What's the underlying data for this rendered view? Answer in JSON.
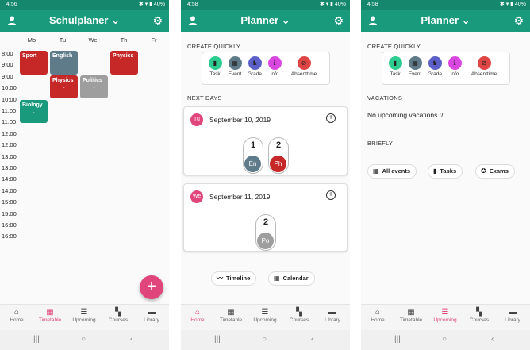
{
  "screens": [
    {
      "status": {
        "time": "4:56",
        "battery": "40%"
      },
      "title": "Schulplaner",
      "days": [
        "Mo",
        "Tu",
        "We",
        "Th",
        "Fr"
      ],
      "hours": [
        "8:00",
        "9:00",
        "9:00",
        "10:00",
        "10:00",
        "11:00",
        "11:00",
        "12:00",
        "12:00",
        "13:00",
        "13:00",
        "14:00",
        "14:00",
        "15:00",
        "15:00",
        "16:00",
        "16:00"
      ],
      "lessons": [
        {
          "name": "Sport",
          "sub": "-",
          "color": "#c62828"
        },
        {
          "name": "English",
          "sub": "-",
          "color": "#5f7b8a"
        },
        {
          "name": "Physics",
          "sub": "-",
          "color": "#c62828"
        },
        {
          "name": "Physics",
          "sub": "-",
          "color": "#c62828"
        },
        {
          "name": "Politics",
          "sub": "-",
          "color": "#9e9e9e"
        },
        {
          "name": "Biology",
          "sub": "-",
          "color": "#1a9a7d"
        }
      ],
      "fab": "+",
      "nav": [
        "Home",
        "Timetable",
        "Upcoming",
        "Courses",
        "Library"
      ],
      "active_nav": "Timetable"
    },
    {
      "status": {
        "time": "4:58",
        "battery": "40%"
      },
      "title": "Planner",
      "create_quickly": "CREATE QUICKLY",
      "quick": [
        "Task",
        "Event",
        "Grade",
        "Info",
        "Absenttime"
      ],
      "next_days": "NEXT DAYS",
      "cards": [
        {
          "day": "Tu",
          "date": "September 10, 2019",
          "entries": [
            {
              "num": "1",
              "abbr": "En",
              "color": "#5f7b8a"
            },
            {
              "num": "2",
              "abbr": "Ph",
              "color": "#c62828"
            }
          ]
        },
        {
          "day": "We",
          "date": "September 11, 2019",
          "entries": [
            {
              "num": "2",
              "abbr": "Po",
              "color": "#9e9e9e"
            }
          ]
        }
      ],
      "buttons": [
        "Timeline",
        "Calendar"
      ],
      "nav": [
        "Home",
        "Timetable",
        "Upcoming",
        "Courses",
        "Library"
      ],
      "active_nav": "Home"
    },
    {
      "status": {
        "time": "4:58",
        "battery": "40%"
      },
      "title": "Planner",
      "create_quickly": "CREATE QUICKLY",
      "quick": [
        "Task",
        "Event",
        "Grade",
        "Info",
        "Absenttime"
      ],
      "vacations": "VACATIONS",
      "no_vacations": "No upcoming vacations :/",
      "briefly": "BRIEFLY",
      "chips": [
        "All events",
        "Tasks",
        "Exams"
      ],
      "nav": [
        "Home",
        "Timetable",
        "Upcoming",
        "Courses",
        "Library"
      ],
      "active_nav": "Upcoming"
    }
  ],
  "colors": {
    "primary": "#1a9a7d",
    "primary_dark": "#14876c",
    "accent": "#e0457b"
  },
  "quick_colors": [
    "#2ecc8f",
    "#5f7b8a",
    "#5b5fc7",
    "#d946e0",
    "#e04545"
  ]
}
